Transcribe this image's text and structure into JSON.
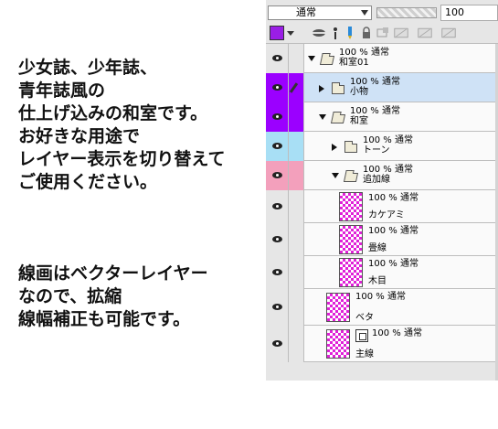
{
  "description": {
    "lines": [
      "少女誌、少年誌、",
      "青年誌風の",
      "仕上げ込みの和室です。",
      "お好きな用途で",
      "レイヤー表示を切り替えて",
      "ご使用ください。"
    ],
    "lines2": [
      "線画はベクターレイヤー",
      "なので、拡縮",
      "線幅補正も可能です。"
    ]
  },
  "layer_panel": {
    "blend_mode": "通常",
    "opacity": "100",
    "main_color": "#9a1ee6",
    "layers": [
      {
        "props": "100 % 通常",
        "name": "和室01",
        "type": "folder",
        "expanded": true,
        "indent": 0,
        "color_tag": null
      },
      {
        "props": "100 % 通常",
        "name": "小物",
        "type": "folder",
        "expanded": false,
        "indent": 1,
        "color_tag": "#9b00ff",
        "selected": true,
        "pen": true
      },
      {
        "props": "100 % 通常",
        "name": "和室",
        "type": "folder",
        "expanded": true,
        "indent": 1,
        "color_tag": "#9b00ff"
      },
      {
        "props": "100 % 通常",
        "name": "トーン",
        "type": "folder",
        "expanded": false,
        "indent": 2,
        "color_tag": "#a8dff5"
      },
      {
        "props": "100 % 通常",
        "name": "追加線",
        "type": "folder",
        "expanded": true,
        "indent": 2,
        "color_tag": "#f3a0bc"
      },
      {
        "props": "100 % 通常",
        "name": "カケアミ",
        "type": "layer",
        "indent": 3,
        "color_tag": null
      },
      {
        "props": "100 % 通常",
        "name": "畳線",
        "type": "layer",
        "indent": 3,
        "color_tag": null
      },
      {
        "props": "100 % 通常",
        "name": "木目",
        "type": "layer",
        "indent": 3,
        "color_tag": null
      },
      {
        "props": "100 % 通常",
        "name": "ベタ",
        "type": "layer",
        "indent": 2,
        "color_tag": null
      },
      {
        "props": "100 % 通常",
        "name": "主線",
        "type": "layer",
        "indent": 2,
        "color_tag": null,
        "vector": true
      }
    ]
  }
}
